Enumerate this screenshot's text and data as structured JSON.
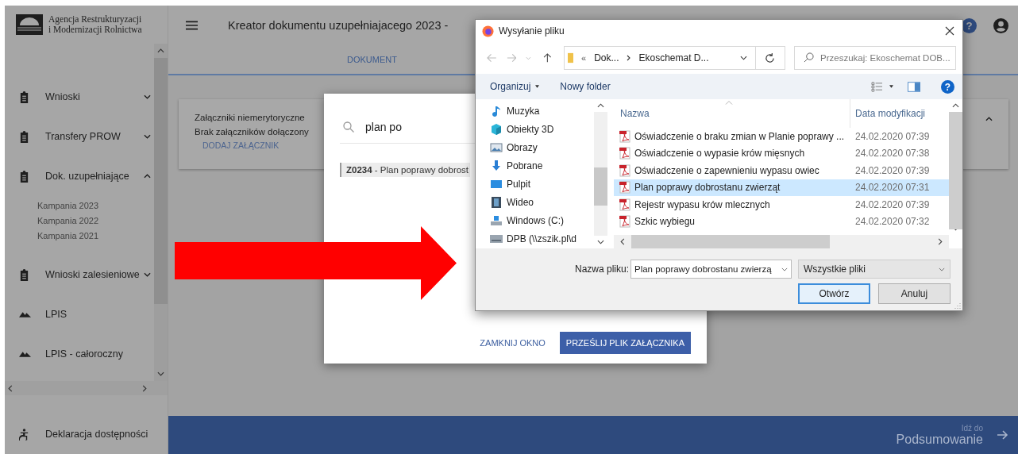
{
  "sidebar": {
    "logo_lines": [
      "Agencja Restrukturyzacji",
      "i Modernizacji Rolnictwa"
    ],
    "items": [
      {
        "label": "Wnioski",
        "kind": "clipboard",
        "expanded": false
      },
      {
        "label": "Transfery PROW",
        "kind": "clipboard",
        "expanded": false
      },
      {
        "label": "Dok. uzupełniające",
        "kind": "clipboard",
        "expanded": true,
        "children": [
          {
            "label": "Kampania 2023"
          },
          {
            "label": "Kampania 2022"
          },
          {
            "label": "Kampania 2021"
          }
        ]
      },
      {
        "label": "Wnioski zalesieniowe",
        "kind": "clipboard",
        "expanded": false
      },
      {
        "label": "LPIS",
        "kind": "mountains"
      },
      {
        "label": "LPIS - całoroczny",
        "kind": "mountains"
      }
    ],
    "footer": {
      "label": "Deklaracja dostępności",
      "kind": "accessibility"
    }
  },
  "header": {
    "title": "Kreator dokumentu uzupełniajacego 2023 -",
    "help_glyph": "?",
    "tabs": [
      {
        "label": "DOKUMENT",
        "selected": true
      }
    ]
  },
  "card": {
    "heading": "Załączniki niemerytoryczne",
    "text": "Brak załączników dołączony",
    "action": "DODAJ ZAŁĄCZNIK",
    "expanded": true
  },
  "bottom_bar": {
    "label": "Idź do",
    "target": "Podsumowanie"
  },
  "modal": {
    "search": {
      "value": "plan po"
    },
    "results": [
      {
        "text": "**Z0234** - Plan poprawy dobrost",
        "selected": true
      }
    ],
    "buttons": [
      {
        "label": "ZAMKNIJ OKNO",
        "kind": "text"
      },
      {
        "label": "PRZEŚLIJ PLIK ZAŁĄCZNIKA",
        "kind": "primary"
      }
    ]
  },
  "file_dialog": {
    "title": "Wysyłanie pliku",
    "path_prefix": "«",
    "path": [
      "Dok...",
      "Ekoschemat D..."
    ],
    "search": {
      "placeholder": "Przeszukaj: Ekoschemat DOB..."
    },
    "toolbar": [
      "Organizuj",
      "Nowy folder"
    ],
    "help_glyph": "?",
    "nav": [
      {
        "label": "Muzyka",
        "kind": "music"
      },
      {
        "label": "Obiekty 3D",
        "kind": "cube"
      },
      {
        "label": "Obrazy",
        "kind": "pictures"
      },
      {
        "label": "Pobrane",
        "kind": "download"
      },
      {
        "label": "Pulpit",
        "kind": "desktop"
      },
      {
        "label": "Wideo",
        "kind": "video"
      },
      {
        "label": "Windows (C:)",
        "kind": "drive"
      },
      {
        "label": "DPB (\\\\zszik.pl\\d",
        "kind": "netdrive"
      }
    ],
    "columns": [
      "Nazwa",
      "Data modyfikacji"
    ],
    "files": [
      {
        "name": "Oświadczenie o braku zmian w Planie poprawy ...",
        "date": "24.02.2020 07:39",
        "selected": false
      },
      {
        "name": "Oświadczenie o wypasie krów mięsnych",
        "date": "24.02.2020 07:38",
        "selected": false
      },
      {
        "name": "Oświadczenie o zapewnieniu wypasu owiec",
        "date": "24.02.2020 07:39",
        "selected": false
      },
      {
        "name": "Plan poprawy dobrostanu zwierząt",
        "date": "24.02.2020 07:31",
        "selected": true
      },
      {
        "name": "Rejestr wypasu krów mlecznych",
        "date": "24.02.2020 07:39",
        "selected": false
      },
      {
        "name": "Szkic wybiegu",
        "date": "24.02.2020 07:32",
        "selected": false
      }
    ],
    "filename_label": "Nazwa pliku:",
    "filename": "Plan poprawy dobrostanu zwierzą",
    "filter": "Wszystkie pliki",
    "buttons": [
      {
        "label": "Otwórz",
        "kind": "default"
      },
      {
        "label": "Anuluj",
        "kind": "normal"
      }
    ]
  }
}
